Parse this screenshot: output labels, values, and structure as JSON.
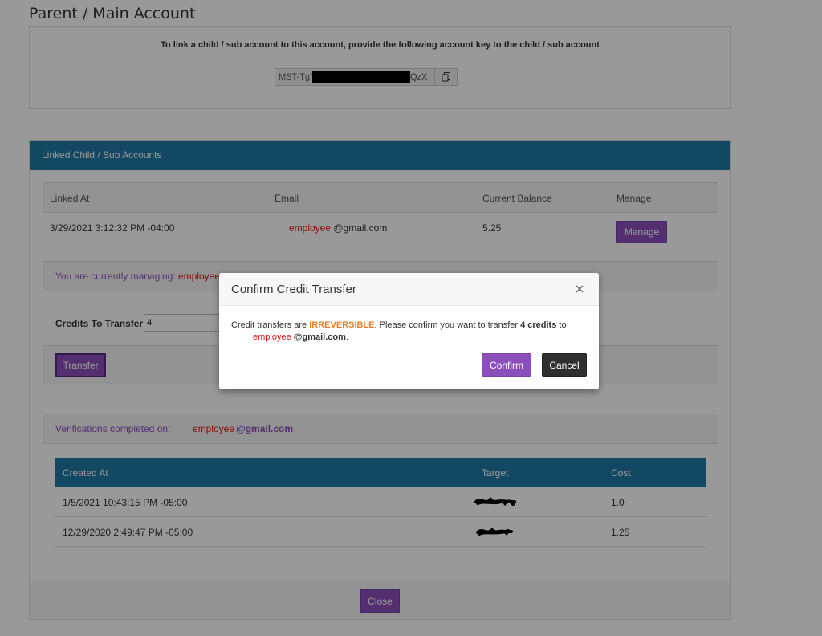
{
  "page": {
    "title": "Parent / Main Account"
  },
  "key_panel": {
    "instruction": "To link a child / sub account to this account, provide the following account key to the child / sub account",
    "key_prefix": "MST-TgT",
    "key_suffix": "QzX",
    "copy_icon": "copy-icon"
  },
  "linked": {
    "heading": "Linked Child / Sub Accounts",
    "columns": [
      "Linked At",
      "Email",
      "Current Balance",
      "Manage"
    ],
    "rows": [
      {
        "linked_at": "3/29/2021 3:12:32 PM -04:00",
        "email_user": "employee",
        "email_domain": "@gmail.com",
        "balance": "5.25",
        "manage_label": "Manage"
      }
    ]
  },
  "managing": {
    "label": "You are currently managing:",
    "user": "employee",
    "credits_label": "Credits To Transfer:",
    "credits_value": "4",
    "transfer_label": "Transfer"
  },
  "verifications": {
    "label": "Verifications completed on:",
    "user": "employee",
    "domain": "@gmail.com",
    "columns": [
      "Created At",
      "Target",
      "Cost"
    ],
    "rows": [
      {
        "created_at": "1/5/2021 10:43:15 PM -05:00",
        "cost": "1.0"
      },
      {
        "created_at": "12/29/2020 2:49:47 PM -05:00",
        "cost": "1.25"
      }
    ]
  },
  "footer": {
    "close_label": "Close"
  },
  "modal": {
    "title": "Confirm Credit Transfer",
    "close_icon": "close-icon",
    "text_1": "Credit transfers are ",
    "warning": "IRREVERSIBLE",
    "text_2": ". Please confirm you want to transfer ",
    "credits": "4 credits",
    "text_3": " to",
    "email_user": "employee",
    "email_domain": "@gmail.com",
    "period": ".",
    "confirm_label": "Confirm",
    "cancel_label": "Cancel"
  }
}
